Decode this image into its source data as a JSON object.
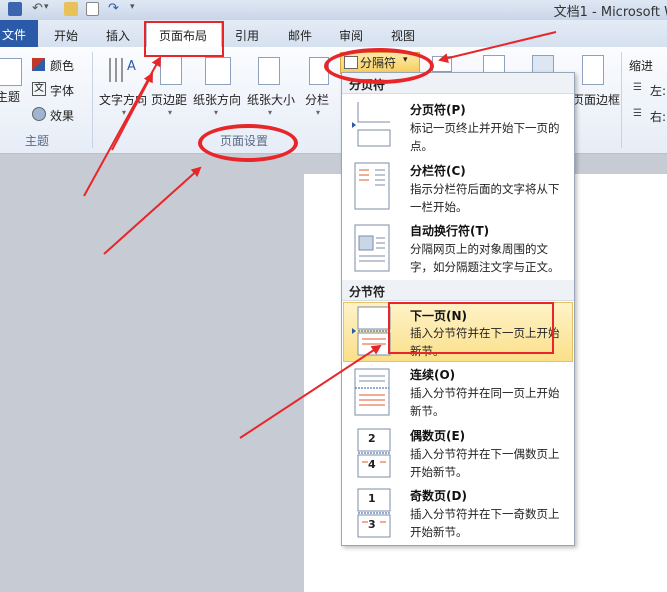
{
  "window": {
    "title": "文档1 - Microsoft W"
  },
  "tabs": [
    "文件",
    "开始",
    "插入",
    "页面布局",
    "引用",
    "邮件",
    "审阅",
    "视图"
  ],
  "ribbon": {
    "theme": {
      "colors": "颜色",
      "fonts": "字体",
      "effects": "效果",
      "themes": "主题",
      "group": "主题"
    },
    "page_setup": {
      "text_direction": "文字方向",
      "margins": "页边距",
      "orientation": "纸张方向",
      "size": "纸张大小",
      "columns": "分栏",
      "breaks": "分隔符",
      "group": "页面设置"
    },
    "page_bg": {
      "borders": "页面边框"
    },
    "paragraph": {
      "indent": "缩进",
      "left": "左:",
      "right": "右:"
    }
  },
  "dropdown": {
    "section_page": "分页符",
    "section_section": "分节符",
    "items": [
      {
        "title": "分页符(P)",
        "desc": "标记一页终止并开始下一页的点。"
      },
      {
        "title": "分栏符(C)",
        "desc": "指示分栏符后面的文字将从下一栏开始。"
      },
      {
        "title": "自动换行符(T)",
        "desc": "分隔网页上的对象周围的文字，如分隔题注文字与正文。"
      },
      {
        "title": "下一页(N)",
        "desc": "插入分节符并在下一页上开始新节。"
      },
      {
        "title": "连续(O)",
        "desc": "插入分节符并在同一页上开始新节。"
      },
      {
        "title": "偶数页(E)",
        "desc": "插入分节符并在下一偶数页上开始新节。"
      },
      {
        "title": "奇数页(D)",
        "desc": "插入分节符并在下一奇数页上开始新节。"
      }
    ]
  },
  "thumb_numbers": {
    "even_top": "2",
    "even_bottom": "4",
    "odd_top": "1",
    "odd_bottom": "3"
  },
  "colors": {
    "annotation_red": "#e8262a",
    "file_tab": "#2a5aa8",
    "highlight": "#fbe08a"
  }
}
